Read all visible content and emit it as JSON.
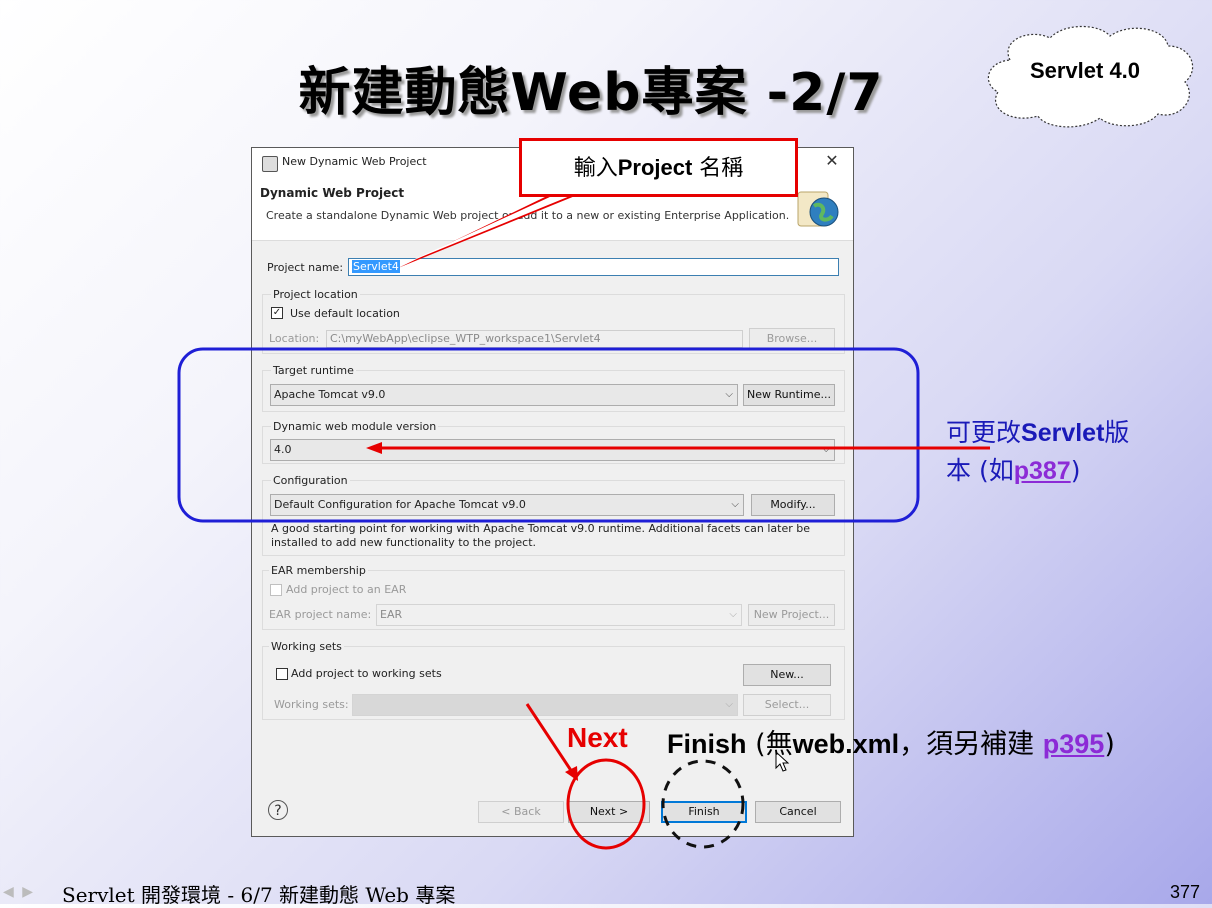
{
  "slide": {
    "title": "新建動態Web專案 -2/7",
    "badge": "Servlet 4.0",
    "footer": "Servlet 開發環境 - 6/7 新建動態 Web 專案",
    "page_number": "377",
    "nav_icons": "◀ ▶"
  },
  "dialog": {
    "window_title": "New Dynamic Web Project",
    "close": "✕",
    "heading": "Dynamic Web Project",
    "description": "Create a standalone Dynamic Web project or add it to a new or existing Enterprise Application.",
    "project_name_label": "Project name:",
    "project_name_value": "Servlet4",
    "project_location": {
      "legend": "Project location",
      "use_default_label": "Use default location",
      "use_default_checked": true,
      "location_label": "Location:",
      "location_value": "C:\\myWebApp\\eclipse_WTP_workspace1\\Servlet4",
      "browse": "Browse..."
    },
    "target_runtime": {
      "legend": "Target runtime",
      "value": "Apache Tomcat v9.0",
      "new_runtime": "New Runtime..."
    },
    "module_version": {
      "legend": "Dynamic web module version",
      "value": "4.0"
    },
    "configuration": {
      "legend": "Configuration",
      "value": "Default Configuration for Apache Tomcat v9.0",
      "modify": "Modify...",
      "description_line1": "A good starting point for working with Apache Tomcat v9.0 runtime. Additional facets can later be",
      "description_line2": "installed to add new functionality to the project."
    },
    "ear": {
      "legend": "EAR membership",
      "add_label": "Add project to an EAR",
      "project_name_label": "EAR project name:",
      "project_name_value": "EAR",
      "new_project": "New Project..."
    },
    "working_sets": {
      "legend": "Working sets",
      "add_label": "Add project to working sets",
      "new": "New...",
      "sets_label": "Working sets:",
      "select": "Select..."
    },
    "buttons": {
      "help": "?",
      "back": "< Back",
      "next": "Next >",
      "finish": "Finish",
      "cancel": "Cancel"
    },
    "chevron": "⌵"
  },
  "annotations": {
    "callout_prefix": "輸入",
    "callout_bold": "Project",
    "callout_suffix": " 名稱",
    "servlet_line1_a": "可更改",
    "servlet_line1_b": "Servlet",
    "servlet_line1_c": "版",
    "servlet_line2_a": "本 (如",
    "servlet_line2_link": "p387",
    "servlet_line2_b": ")",
    "next_note": "Next",
    "finish_a": "Finish",
    "finish_b": " (無",
    "finish_c": "web.xml",
    "finish_d": "，須另補建 ",
    "finish_link": "p395",
    "finish_e": ")",
    "colors": {
      "red": "#e60000",
      "blue": "#1a1ab8",
      "link": "#8c2bd6"
    }
  }
}
